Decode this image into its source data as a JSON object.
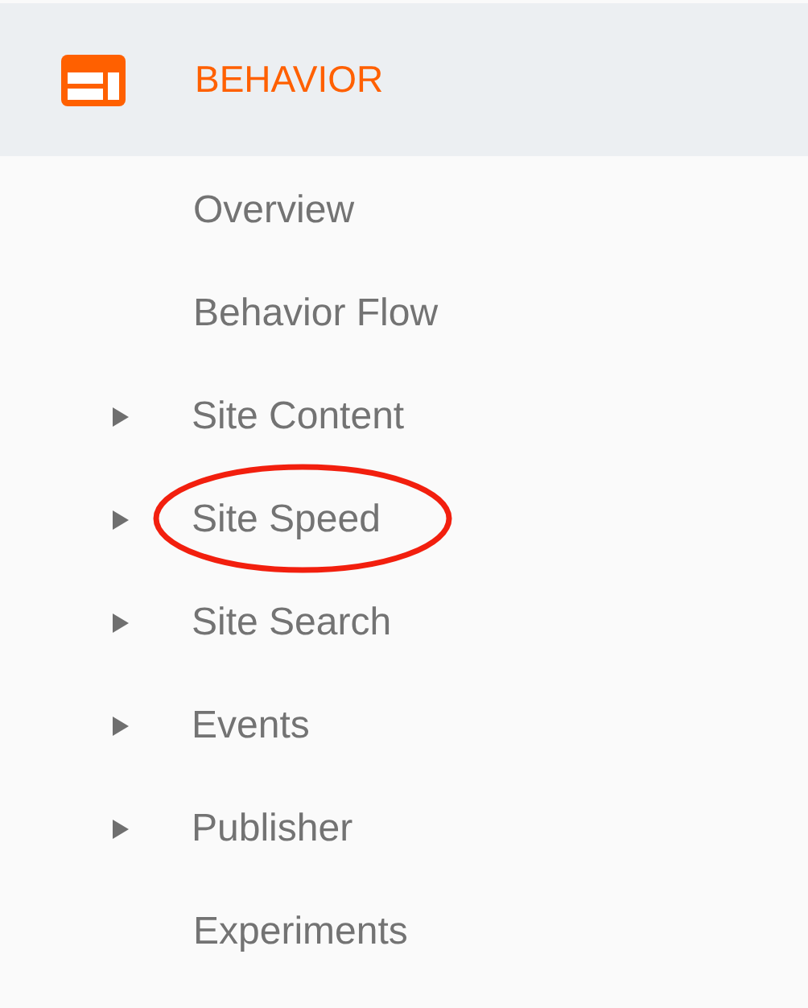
{
  "section": {
    "title": "BEHAVIOR"
  },
  "items": [
    {
      "label": "Overview",
      "kind": "link",
      "circled": false
    },
    {
      "label": "Behavior Flow",
      "kind": "link",
      "circled": false
    },
    {
      "label": "Site Content",
      "kind": "group",
      "circled": false
    },
    {
      "label": "Site Speed",
      "kind": "group",
      "circled": true
    },
    {
      "label": "Site Search",
      "kind": "group",
      "circled": false
    },
    {
      "label": "Events",
      "kind": "group",
      "circled": false
    },
    {
      "label": "Publisher",
      "kind": "group",
      "circled": false
    },
    {
      "label": "Experiments",
      "kind": "link",
      "circled": false
    }
  ]
}
